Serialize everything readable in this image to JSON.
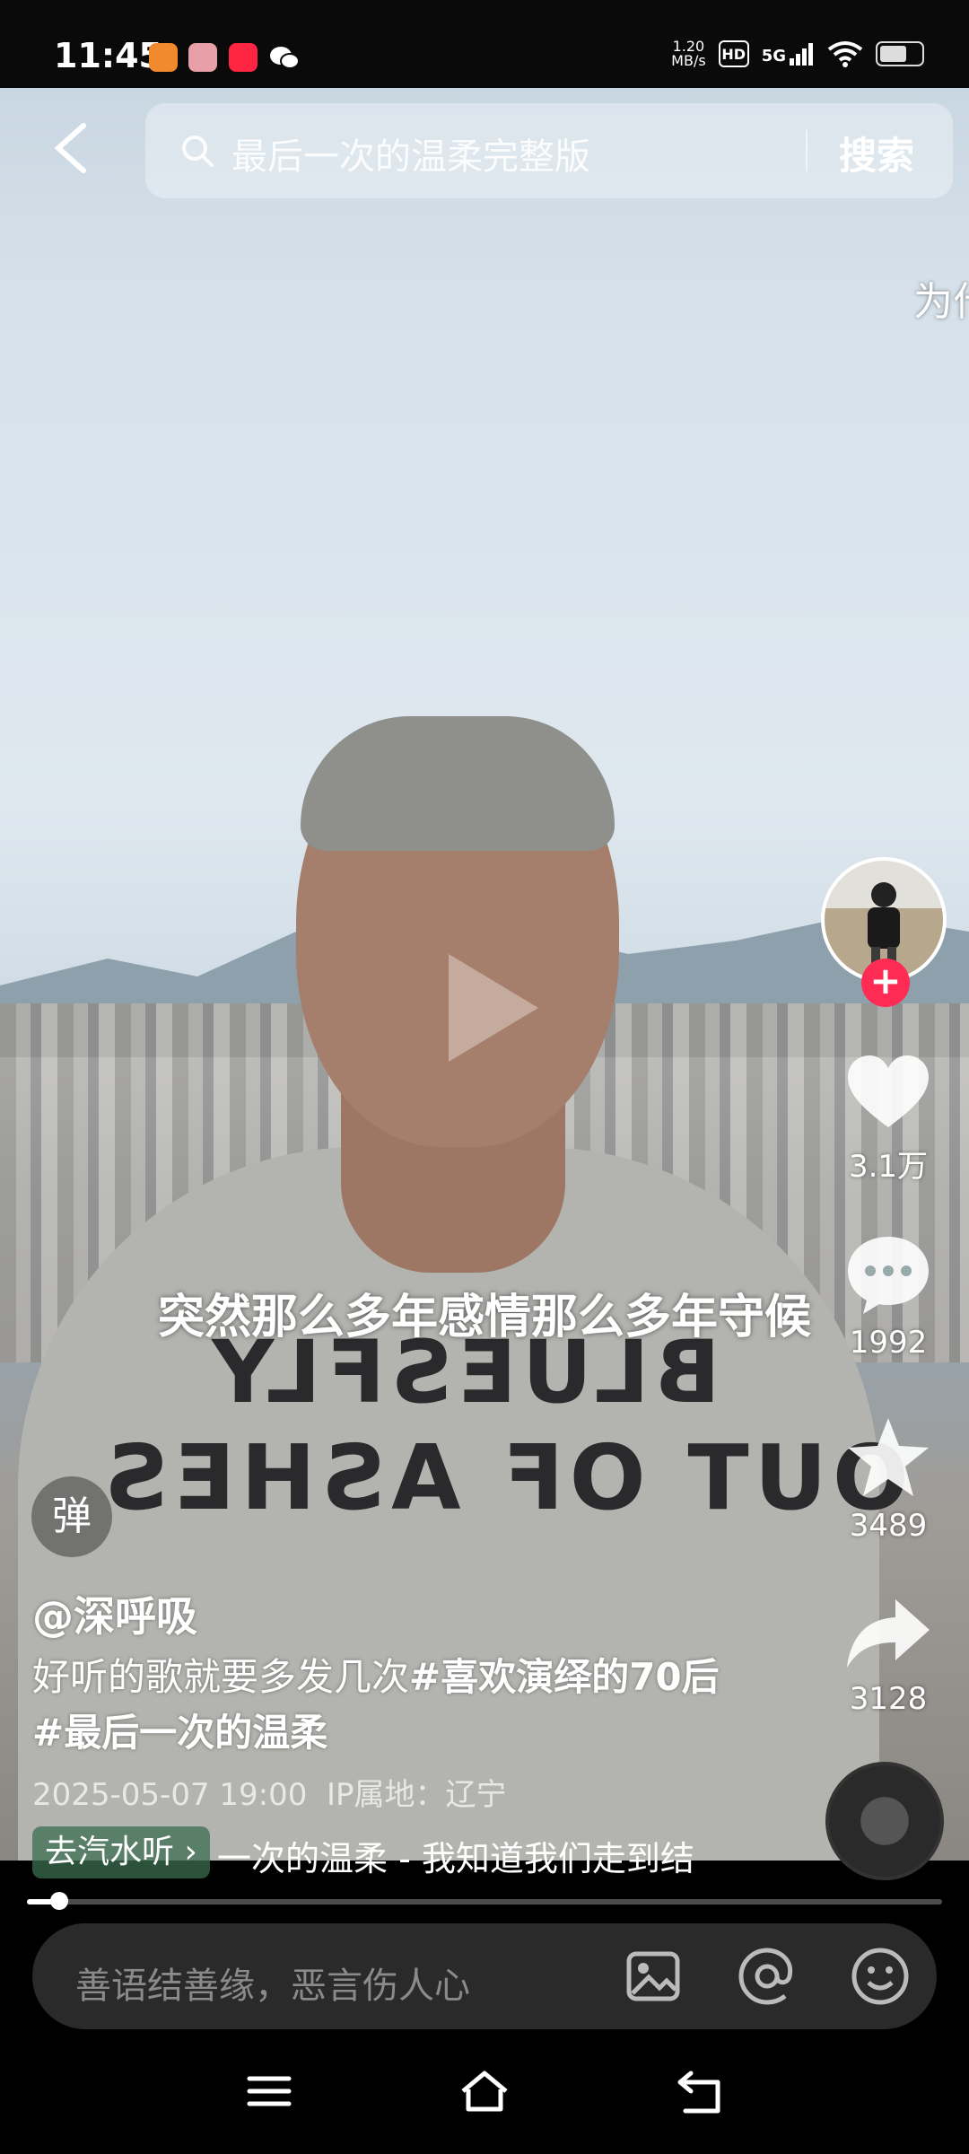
{
  "status_bar": {
    "time": "11:45",
    "net_speed_value": "1.20",
    "net_speed_unit": "MB/s",
    "hd_badge": "HD",
    "network": "5G",
    "battery_level": 0.7
  },
  "search": {
    "query": "最后一次的温柔完整版",
    "button_label": "搜索"
  },
  "edge_overlay_text": "为什",
  "video": {
    "shirt_line1": "BLUESFLY",
    "shirt_line2": "OUT OF ASHES",
    "subtitle": "突然那么多年感情那么多年守候"
  },
  "actions": {
    "likes": "3.1万",
    "comments": "1992",
    "favorites": "3489",
    "shares": "3128",
    "follow_symbol": "+"
  },
  "post": {
    "danmu_label": "弹",
    "username": "@深呼吸",
    "description_plain": "好听的歌就要多发几次",
    "hashtag1": "#喜欢演绎的70后",
    "hashtag2": "#最后一次的温柔",
    "datetime": "2025-05-07 19:00",
    "ip_location": "IP属地：辽宁",
    "music_chip": "去汽水听 ›",
    "music_title": "一次的温柔 - 我知道我们走到结"
  },
  "progress": {
    "fraction": 0.035
  },
  "comment": {
    "placeholder": "善语结善缘，恶言伤人心"
  },
  "colors": {
    "follow_red": "#fe2c55",
    "comment_bar_bg": "#2a2a2a"
  }
}
